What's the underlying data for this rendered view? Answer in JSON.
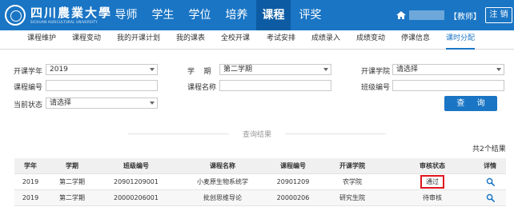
{
  "header": {
    "logo_cn": "四川農業大學",
    "logo_en": "SICHUAN AGRICULTURAL UNIVERSITY",
    "nav": [
      "导师",
      "学生",
      "学位",
      "培养",
      "课程",
      "评奖"
    ],
    "active_nav": "课程",
    "user_role": "【教师】",
    "logout_label": "注 销"
  },
  "subnav": {
    "items": [
      "课程维护",
      "课程变动",
      "我的开课计划",
      "我的课表",
      "全校开课",
      "考试安排",
      "成绩录入",
      "成绩变动",
      "停课信息",
      "课时分配"
    ],
    "active": "课时分配"
  },
  "form": {
    "year_label": "开课学年",
    "year_value": "2019",
    "term_label": "学    期",
    "term_value": "第二学期",
    "college_label": "开课学院",
    "college_value": "请选择",
    "course_code_label": "课程编号",
    "course_code_value": "",
    "course_name_label": "课程名称",
    "course_name_value": "",
    "class_code_label": "班级编号",
    "class_code_value": "",
    "state_label": "当前状态",
    "state_value": "请选择",
    "search_label": "查 询"
  },
  "results": {
    "title": "查询结果",
    "count_text": "共2个结果",
    "columns": [
      "学年",
      "学期",
      "班级编号",
      "课程名称",
      "课程编号",
      "开课学院",
      "审核状态",
      "详情"
    ],
    "rows": [
      [
        "2019",
        "第二学期",
        "20901209001",
        "小麦原生物系统学",
        "20901209",
        "农学院",
        "通过",
        "search-icon"
      ],
      [
        "2019",
        "第二学期",
        "20000206001",
        "批创思维导论",
        "20000206",
        "研究生院",
        "待审核",
        "search-icon"
      ]
    ],
    "highlight_color": "#e0141e"
  },
  "colors": {
    "brand": "#1a75c4",
    "brand_dark": "#0d5ca3"
  }
}
